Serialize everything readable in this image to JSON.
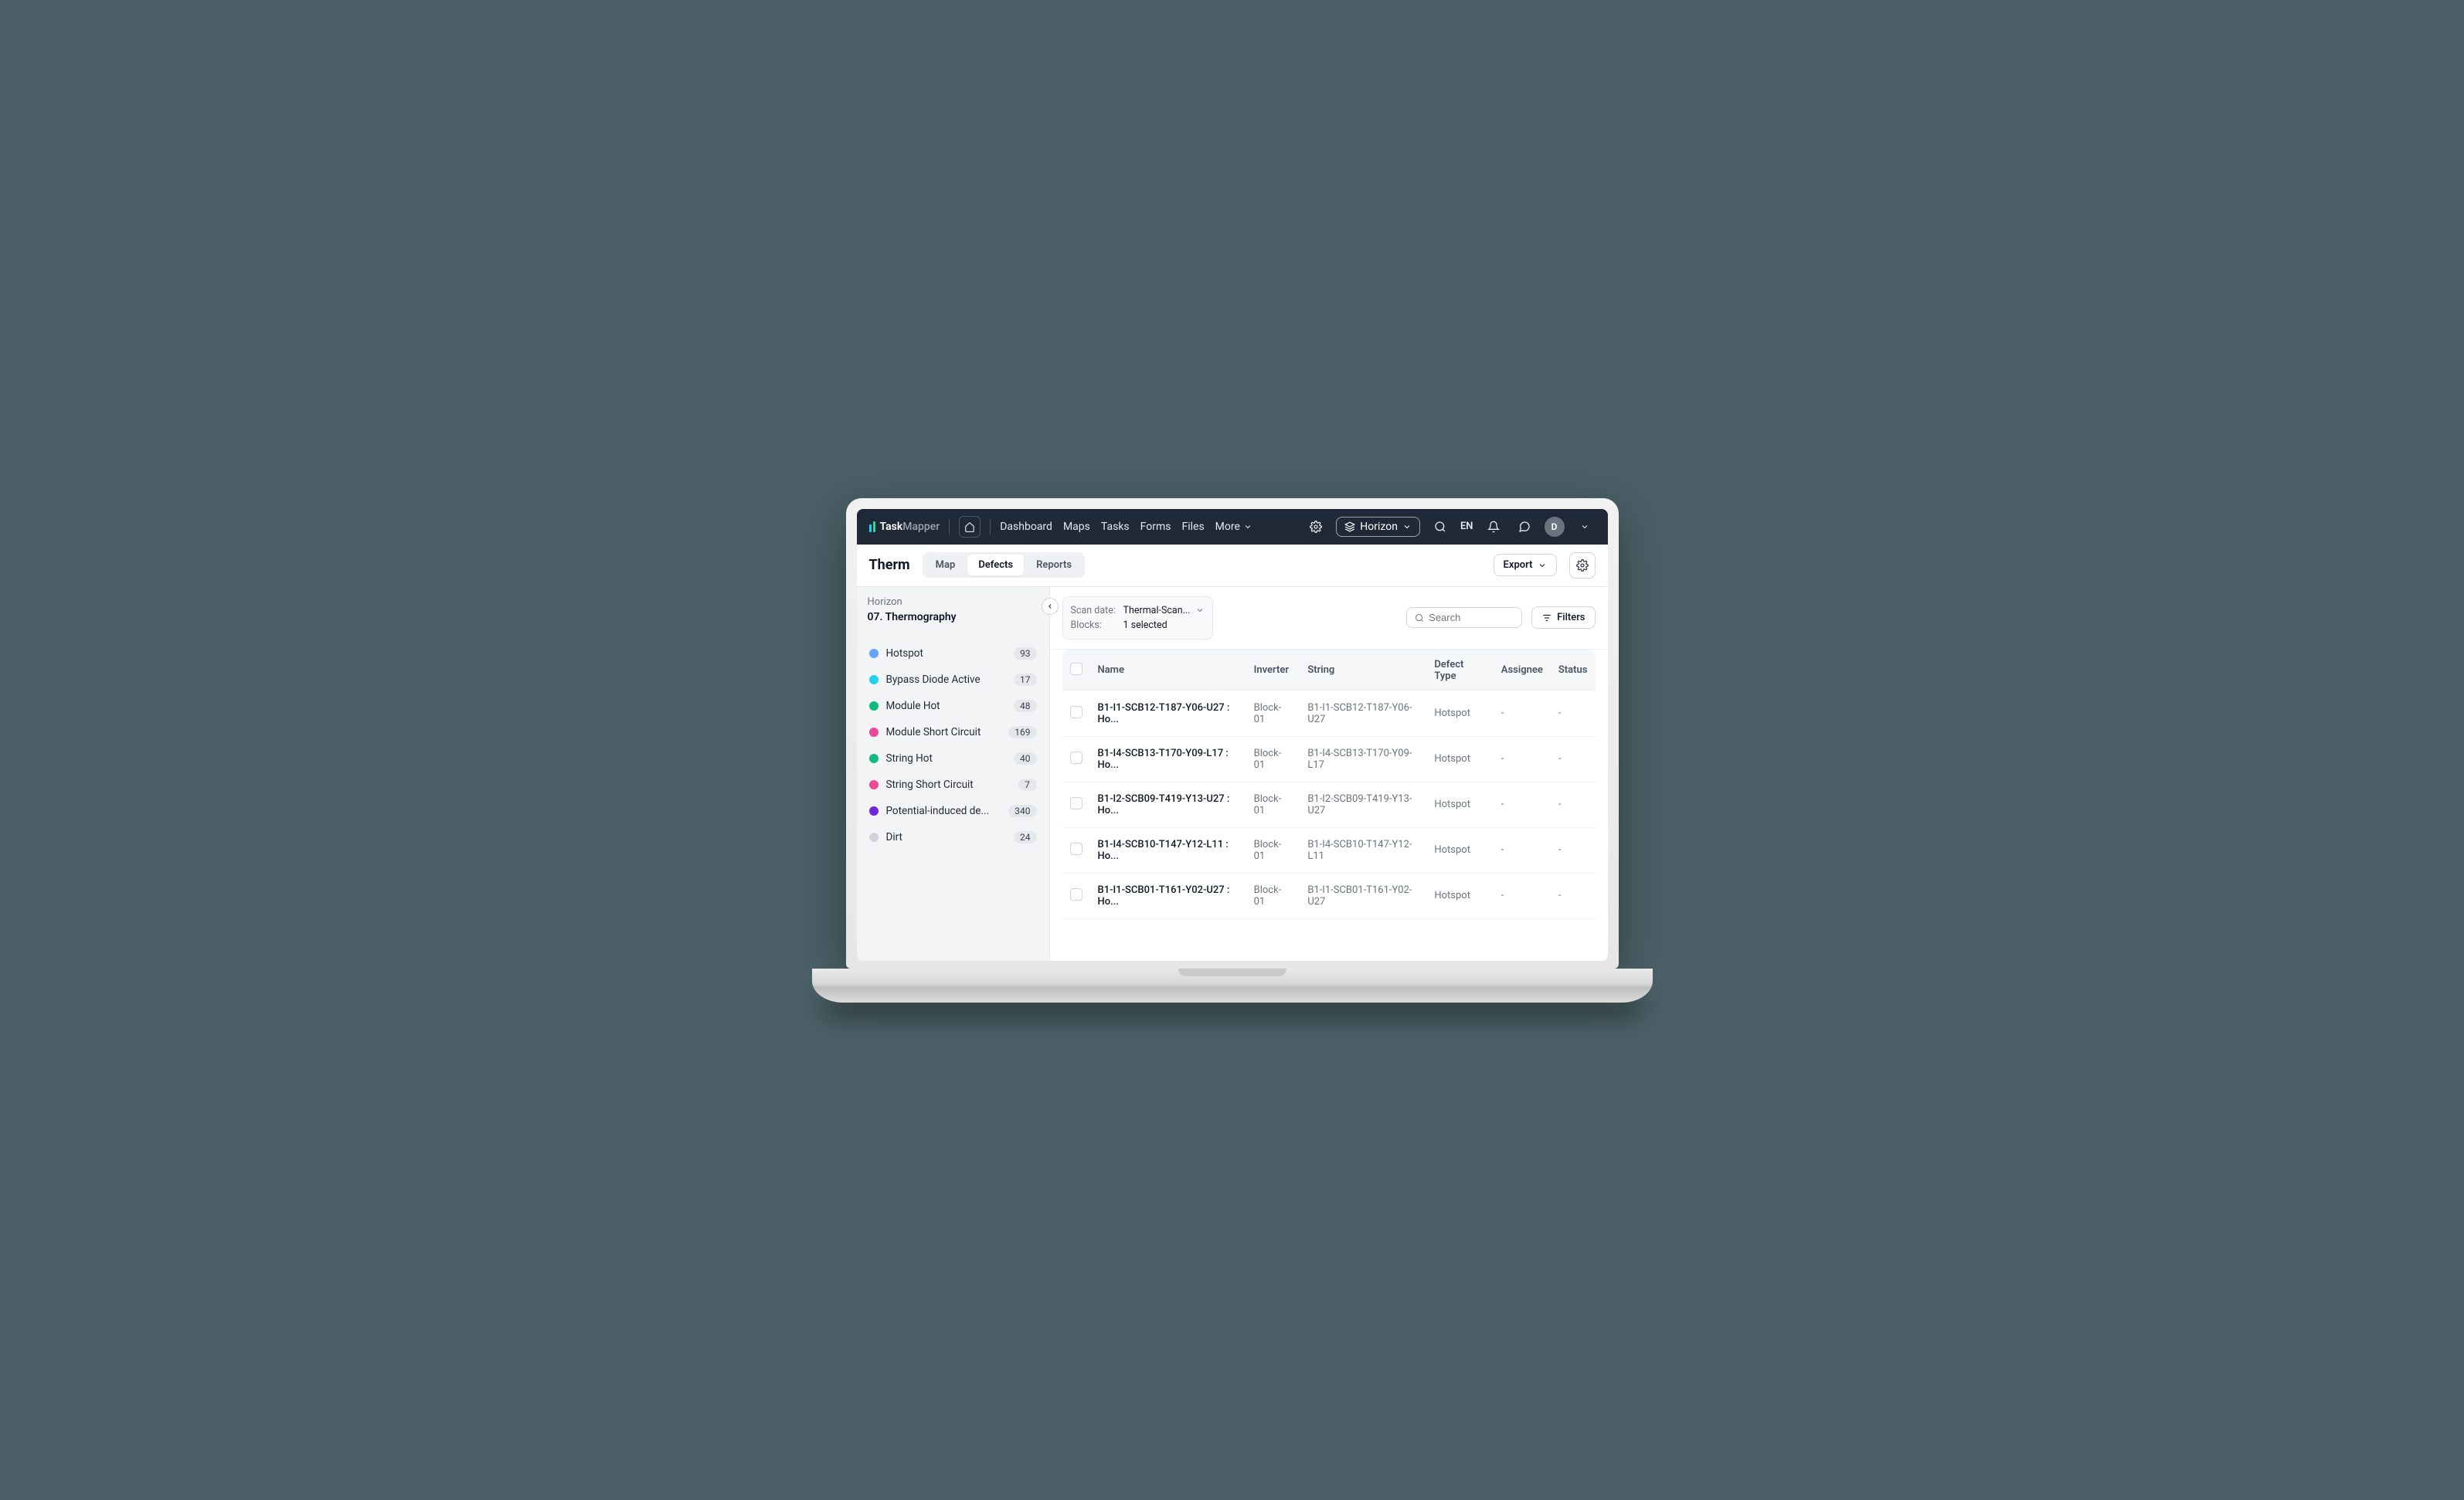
{
  "topnav": {
    "brand_task": "Task",
    "brand_mapper": "Mapper",
    "links": [
      "Dashboard",
      "Maps",
      "Tasks",
      "Forms",
      "Files"
    ],
    "more": "More",
    "project": "Horizon",
    "lang": "EN",
    "avatar_letter": "D"
  },
  "subhead": {
    "title": "Therm",
    "tabs": [
      {
        "label": "Map",
        "active": false
      },
      {
        "label": "Defects",
        "active": true
      },
      {
        "label": "Reports",
        "active": false
      }
    ],
    "export": "Export"
  },
  "sidebar": {
    "project": "Horizon",
    "subproject": "07. Thermography",
    "categories": [
      {
        "label": "Hotspot",
        "count": "93",
        "color": "#60a5fa"
      },
      {
        "label": "Bypass Diode Active",
        "count": "17",
        "color": "#22d3ee"
      },
      {
        "label": "Module Hot",
        "count": "48",
        "color": "#10b981"
      },
      {
        "label": "Module Short Circuit",
        "count": "169",
        "color": "#ec4899"
      },
      {
        "label": "String Hot",
        "count": "40",
        "color": "#10b981"
      },
      {
        "label": "String Short Circuit",
        "count": "7",
        "color": "#ec4899"
      },
      {
        "label": "Potential-induced de...",
        "count": "340",
        "color": "#6d28d9"
      },
      {
        "label": "Dirt",
        "count": "24",
        "color": "#d1d5db"
      }
    ]
  },
  "toolbar": {
    "scan_label": "Scan date:",
    "scan_value": "Thermal-Scan...",
    "blocks_label": "Blocks:",
    "blocks_value": "1 selected",
    "search_placeholder": "Search",
    "filters": "Filters"
  },
  "table": {
    "columns": [
      "Name",
      "Inverter",
      "String",
      "Defect Type",
      "Assignee",
      "Status"
    ],
    "rows": [
      {
        "name": "B1-I1-SCB12-T187-Y06-U27 : Ho...",
        "inverter": "Block-01",
        "string": "B1-I1-SCB12-T187-Y06-U27",
        "type": "Hotspot",
        "assignee": "-",
        "status": "-"
      },
      {
        "name": "B1-I4-SCB13-T170-Y09-L17 : Ho...",
        "inverter": "Block-01",
        "string": "B1-I4-SCB13-T170-Y09-L17",
        "type": "Hotspot",
        "assignee": "-",
        "status": "-"
      },
      {
        "name": "B1-I2-SCB09-T419-Y13-U27 : Ho...",
        "inverter": "Block-01",
        "string": "B1-I2-SCB09-T419-Y13-U27",
        "type": "Hotspot",
        "assignee": "-",
        "status": "-"
      },
      {
        "name": "B1-I4-SCB10-T147-Y12-L11 : Ho...",
        "inverter": "Block-01",
        "string": "B1-I4-SCB10-T147-Y12-L11",
        "type": "Hotspot",
        "assignee": "-",
        "status": "-"
      },
      {
        "name": "B1-I1-SCB01-T161-Y02-U27 : Ho...",
        "inverter": "Block-01",
        "string": "B1-I1-SCB01-T161-Y02-U27",
        "type": "Hotspot",
        "assignee": "-",
        "status": "-"
      }
    ]
  }
}
